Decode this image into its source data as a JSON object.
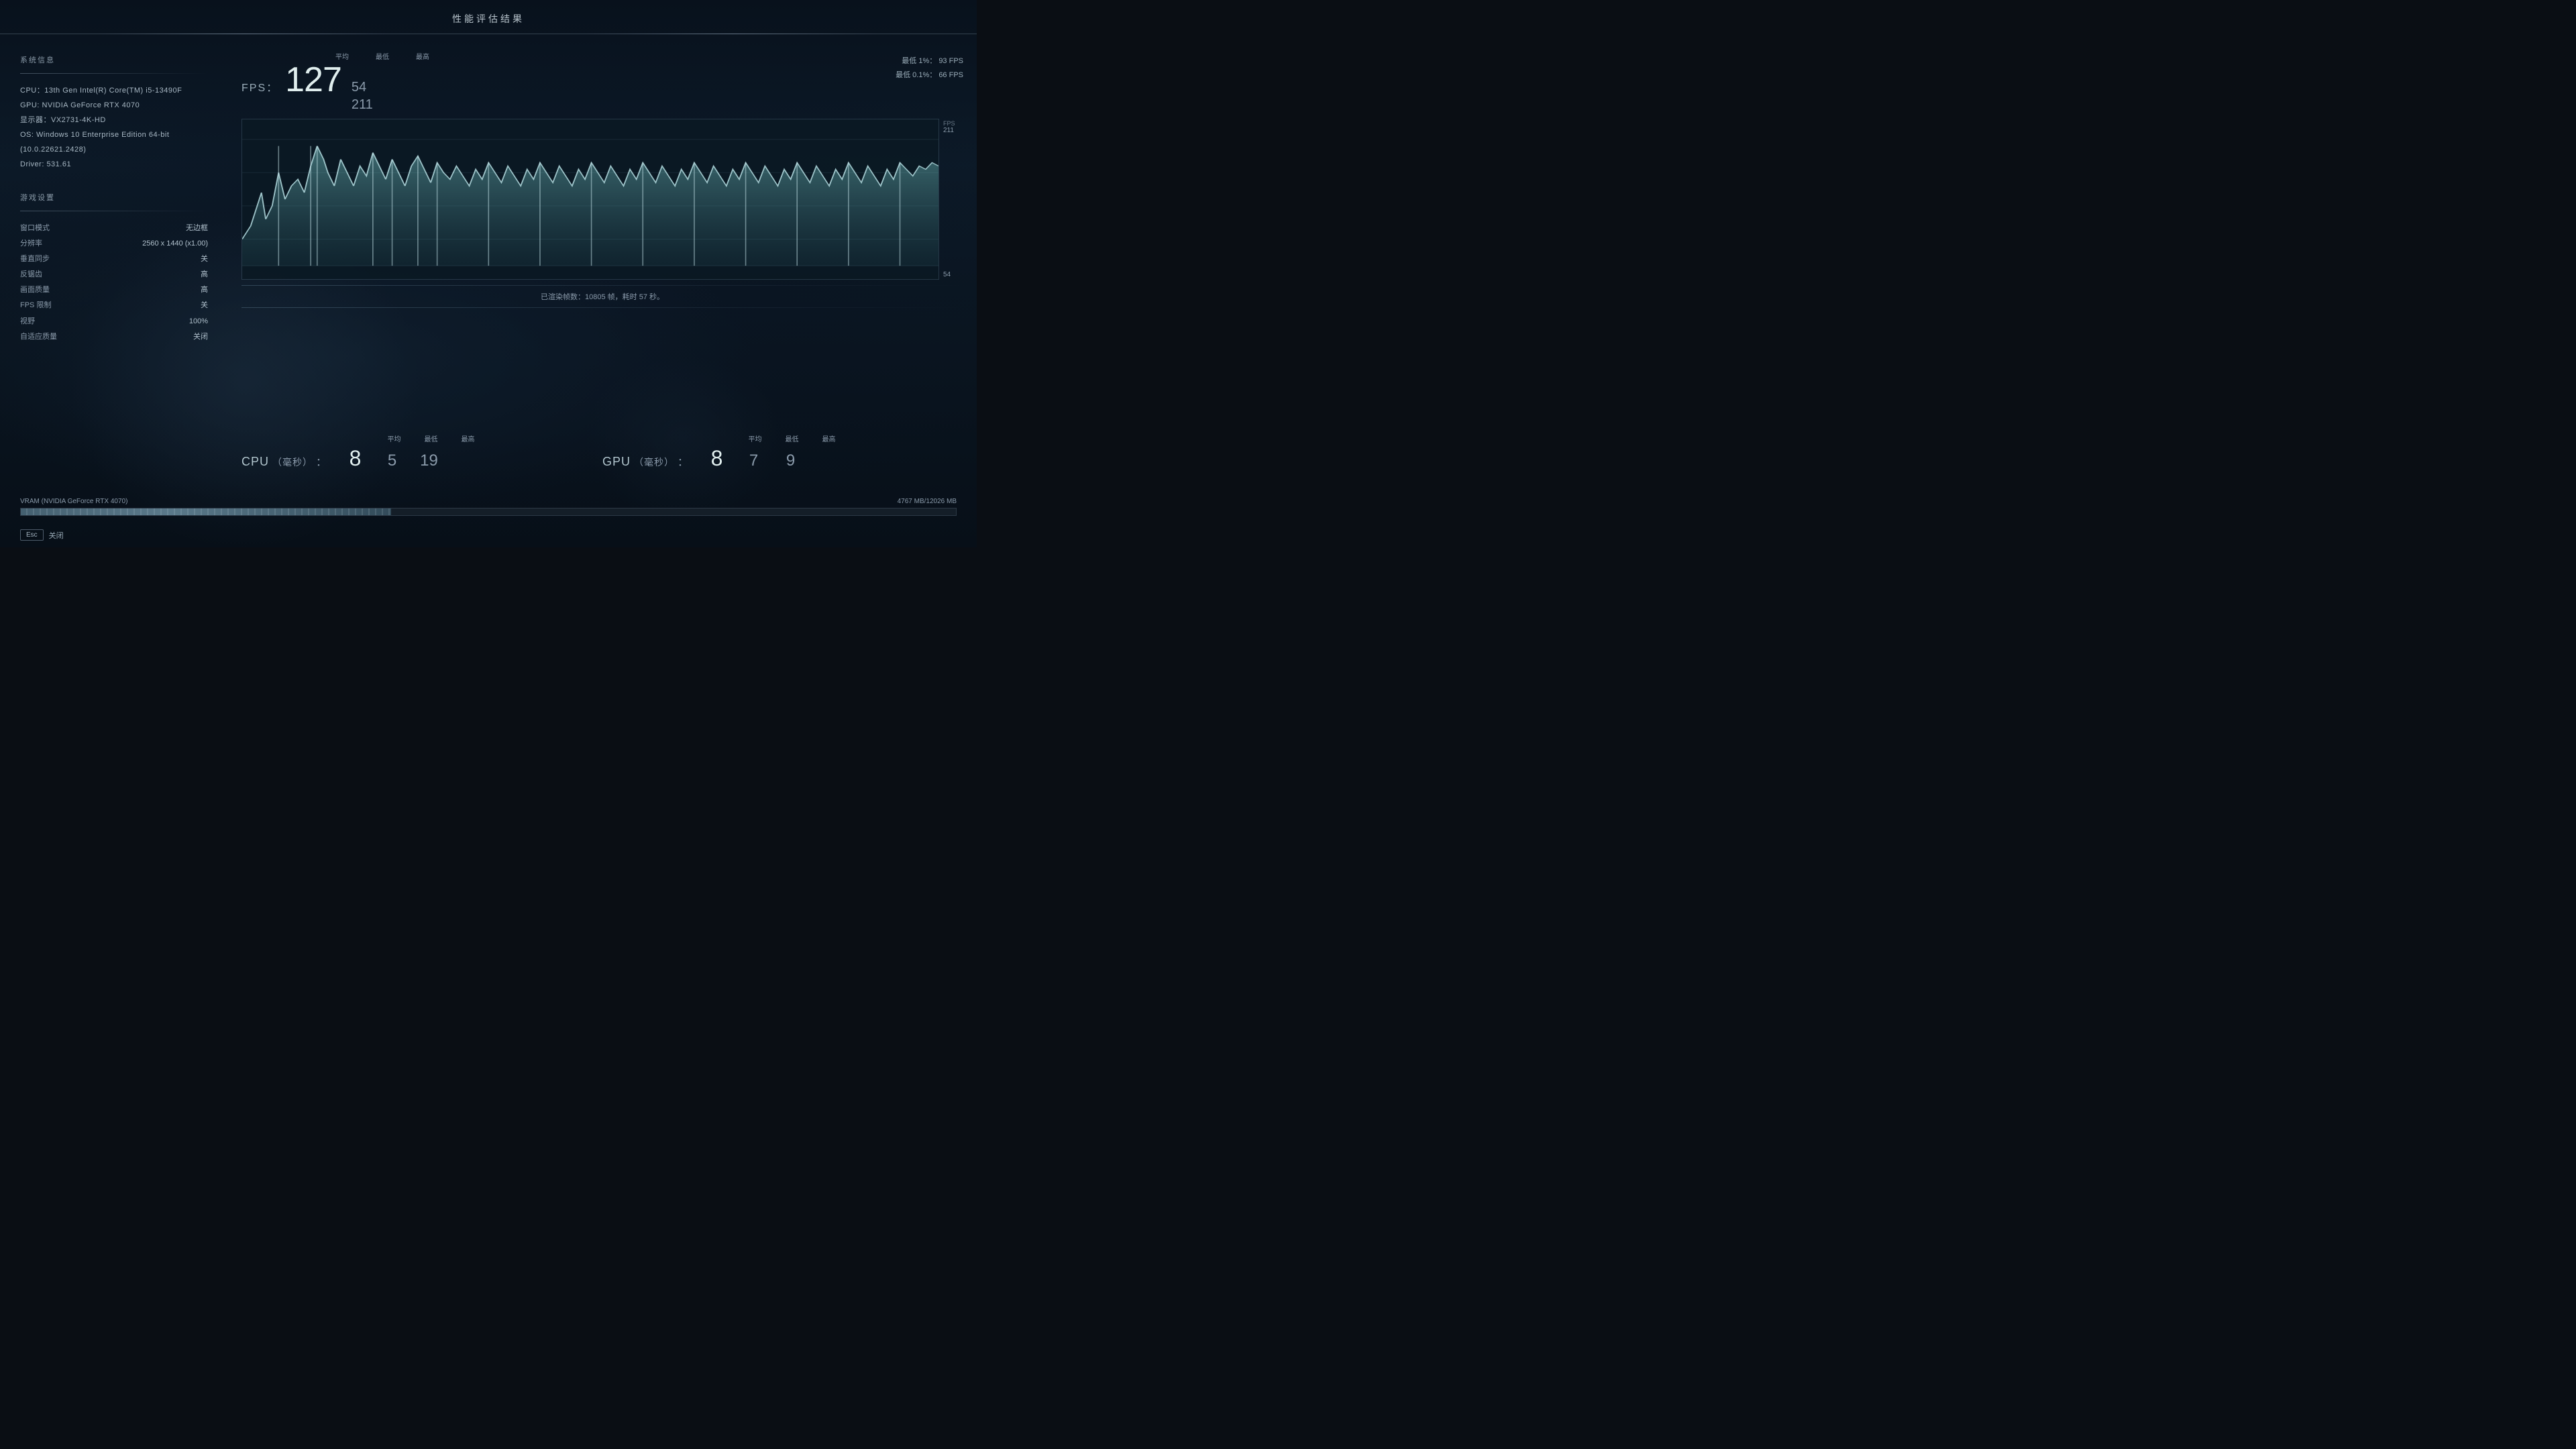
{
  "title": "性能评估结果",
  "system_info": {
    "section_title": "系统信息",
    "lines": [
      "CPU：13th Gen Intel(R) Core(TM) i5-13490F",
      "GPU: NVIDIA GeForce RTX 4070",
      "显示器：VX2731-4K-HD",
      "OS: Windows 10 Enterprise Edition 64-bit (10.0.22621.2428)",
      "Driver: 531.61"
    ]
  },
  "game_settings": {
    "section_title": "游戏设置",
    "rows": [
      {
        "label": "窗口模式",
        "value": "无边框"
      },
      {
        "label": "分辨率",
        "value": "2560 x 1440 (x1.00)"
      },
      {
        "label": "垂直同步",
        "value": "关"
      },
      {
        "label": "反锯齿",
        "value": "高"
      },
      {
        "label": "画面质量",
        "value": "高"
      },
      {
        "label": "FPS 限制",
        "value": "关"
      },
      {
        "label": "视野",
        "value": "100%"
      },
      {
        "label": "自适应质量",
        "value": "关闭"
      }
    ]
  },
  "fps_stats": {
    "label": "FPS：",
    "headers": {
      "avg": "平均",
      "min": "最低",
      "max": "最高"
    },
    "avg": "127",
    "min": "54",
    "max": "211",
    "low1pct_label": "最低 1%：",
    "low1pct_value": "93 FPS",
    "low01pct_label": "最低 0.1%：",
    "low01pct_value": "66 FPS",
    "chart_max": "211",
    "chart_min": "54",
    "chart_fps_label": "FPS",
    "rendered_frames": "已渲染帧数：10805 帧，耗时 57 秒。"
  },
  "cpu_stats": {
    "label": "CPU（毫秒）：",
    "headers": {
      "avg": "平均",
      "min": "最低",
      "max": "最高"
    },
    "avg": "8",
    "min": "5",
    "max": "19"
  },
  "gpu_stats": {
    "label": "GPU（毫秒）：",
    "headers": {
      "avg": "平均",
      "min": "最低",
      "max": "最高"
    },
    "avg": "8",
    "min": "7",
    "max": "9"
  },
  "vram": {
    "label": "VRAM (NVIDIA GeForce RTX 4070)",
    "used": "4767 MB",
    "total": "12026 MB",
    "display": "4767 MB/12026 MB",
    "fill_percent": 39.6
  },
  "footer": {
    "esc_label": "Esc",
    "close_label": "关闭"
  }
}
